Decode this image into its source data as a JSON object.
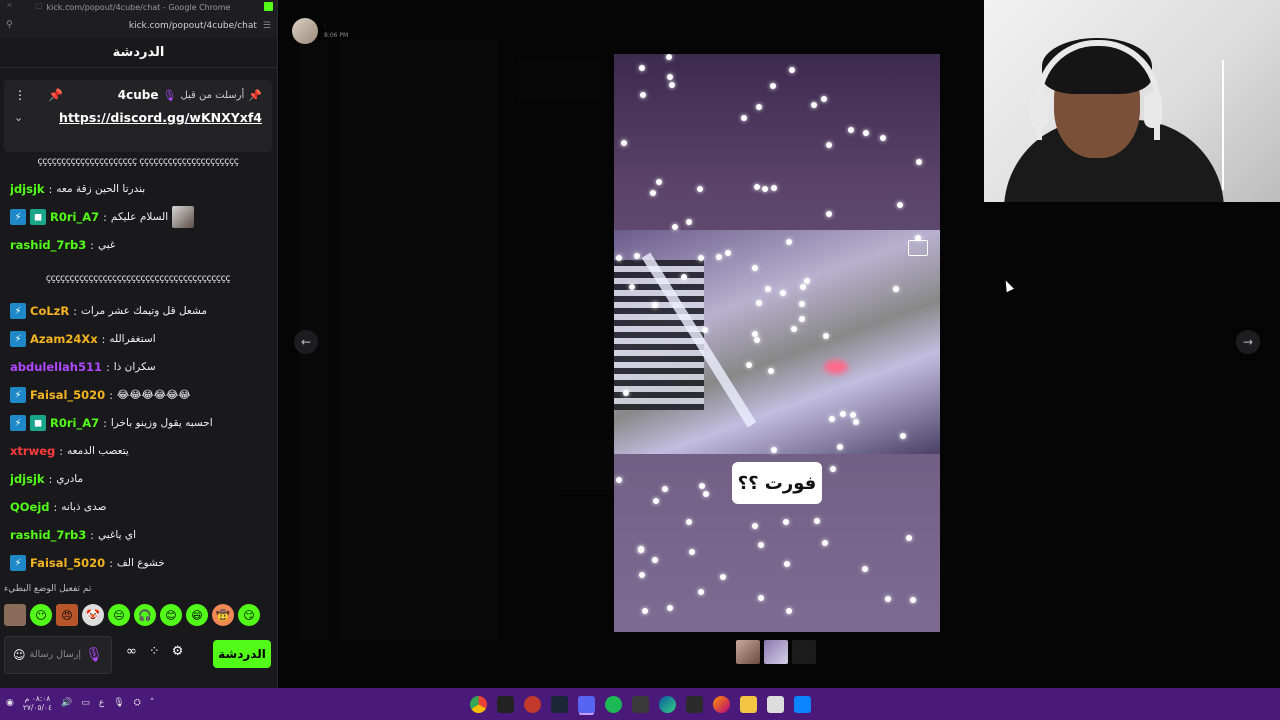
{
  "browser": {
    "window_title": "kick.com/popout/4cube/chat - Google Chrome",
    "url": "kick.com/popout/4cube/chat"
  },
  "chat": {
    "header": "الدردشة",
    "pinned": {
      "pinned_by_label": "أرسلت من قبل",
      "username": "4cube",
      "link": "https://discord.gg/wKNXYxf4"
    },
    "spam_line_1": "ççççççççççççççççççççç ççççççççççççççççççççç",
    "spam_line_2": "ççççççççççççççççççççççççççççççççççççççç",
    "messages": [
      {
        "user": "jdjsjk",
        "text": "بندرتا الحين زقة معه",
        "color": "#53fc18",
        "badges": []
      },
      {
        "user": "R0ri_A7",
        "text": "السلام عليكم",
        "color": "#53fc18",
        "badges": [
          "bolt",
          "sub"
        ],
        "avatar": true
      },
      {
        "user": "rashid_7rb3",
        "text": "غبي",
        "color": "#53fc18",
        "badges": []
      },
      {
        "user": "CoLzR",
        "text": "مشعل قل وتيمك عشر مرات",
        "color": "#f5b321",
        "badges": [
          "bolt"
        ]
      },
      {
        "user": "Azam24Xx",
        "text": "استغفرالله",
        "color": "#f5b321",
        "badges": [
          "bolt"
        ]
      },
      {
        "user": "abdulellah511",
        "text": "سكران ذا",
        "color": "#b048ff",
        "badges": []
      },
      {
        "user": "Faisal_5020",
        "text": "😂😂😂😂😂😂",
        "color": "#f5b321",
        "badges": [
          "bolt"
        ]
      },
      {
        "user": "R0ri_A7",
        "text": "احسبه يقول وزينو باخرا",
        "color": "#53fc18",
        "badges": [
          "bolt",
          "sub"
        ]
      },
      {
        "user": "xtrweg",
        "text": "يتعصب الدمعه",
        "color": "#ff3b3b",
        "badges": []
      },
      {
        "user": "jdjsjk",
        "text": "مادري",
        "color": "#53fc18",
        "badges": []
      },
      {
        "user": "QOejd",
        "text": "صدى ذبانه",
        "color": "#53fc18",
        "badges": []
      },
      {
        "user": "rashid_7rb3",
        "text": "اي ياغبي",
        "color": "#53fc18",
        "badges": []
      },
      {
        "user": "Faisal_5020",
        "text": "خشوع الف",
        "color": "#f5b321",
        "badges": [
          "bolt"
        ]
      }
    ],
    "slow_mode_notice": "تم تفعيل الوضع البطيء",
    "input_placeholder": "إرسال رسالة",
    "chat_button": "الدردشة"
  },
  "viewer": {
    "poster_name": "·",
    "poster_time": "8:06 PM",
    "caption": "فورت ؟؟"
  },
  "taskbar": {
    "clock_time": "٠٨:٠٨ م",
    "clock_date": "٢٧/٠٥/٠٤",
    "lang": "ع"
  },
  "colors": {
    "kick_green": "#53fc18",
    "taskbar": "#4a1a7a",
    "chat_bg": "#19191c"
  }
}
